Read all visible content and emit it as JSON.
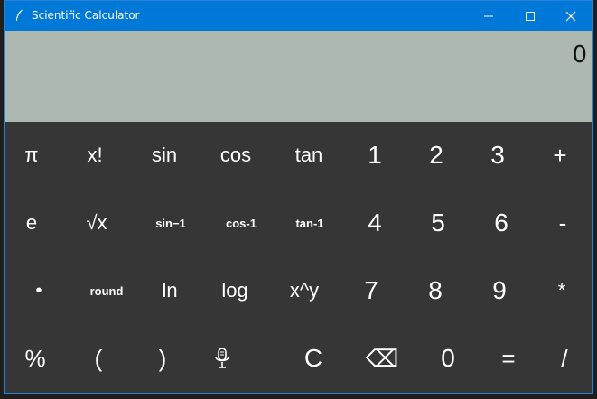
{
  "window": {
    "title": "Scientific Calculator"
  },
  "display": {
    "value": "0"
  },
  "keys": {
    "pi": "π",
    "factorial": "x!",
    "sin": "sin",
    "cos": "cos",
    "tan": "tan",
    "one": "1",
    "two": "2",
    "three": "3",
    "plus": "+",
    "e": "e",
    "sqrt": "√x",
    "asin": "sin−1",
    "acos": "cos-1",
    "atan": "tan-1",
    "four": "4",
    "five": "5",
    "six": "6",
    "minus": "-",
    "dot": "•",
    "round": "round",
    "ln": "ln",
    "log": "log",
    "pow": "x^y",
    "seven": "7",
    "eight": "8",
    "nine": "9",
    "multiply": "*",
    "percent": "%",
    "lparen": "(",
    "rparen": ")",
    "clear": "C",
    "backspace": "⌫",
    "zero": "0",
    "equals": "=",
    "divide": "/"
  },
  "icons": {
    "app": "feather-icon",
    "mic": "microphone-icon"
  },
  "colors": {
    "titlebar": "#0078d7",
    "display_bg": "#adb9b0",
    "keypad_bg": "#363636"
  }
}
